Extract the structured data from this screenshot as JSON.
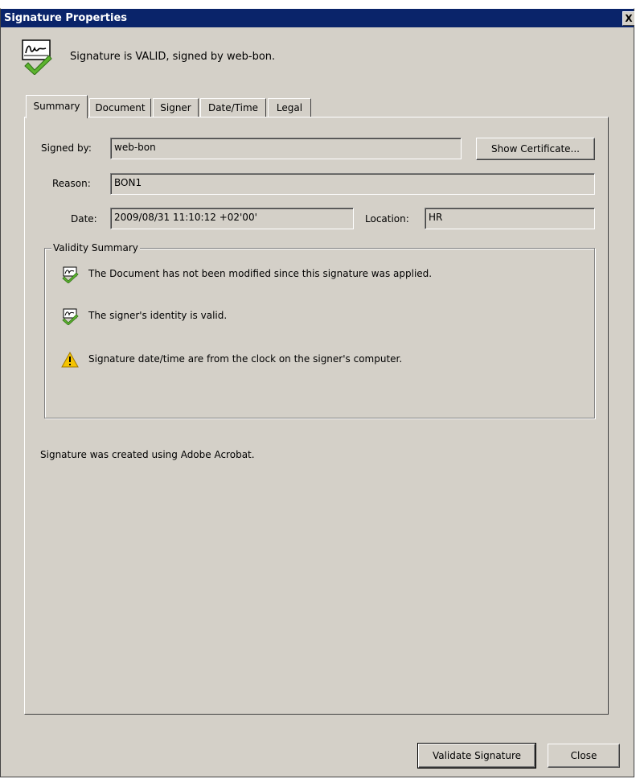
{
  "window": {
    "title": "Signature Properties",
    "close_glyph": "X"
  },
  "header": {
    "icon": "signature-valid-icon",
    "text": "Signature is VALID, signed by web-bon."
  },
  "tabs": [
    {
      "label": "Summary",
      "active": true
    },
    {
      "label": "Document",
      "active": false
    },
    {
      "label": "Signer",
      "active": false
    },
    {
      "label": "Date/Time",
      "active": false
    },
    {
      "label": "Legal",
      "active": false
    }
  ],
  "summary": {
    "signed_by_label": "Signed by:",
    "signed_by_value": "web-bon",
    "show_certificate_label": "Show Certificate...",
    "reason_label": "Reason:",
    "reason_value": "BON1",
    "date_label": "Date:",
    "date_value": "2009/08/31 11:10:12 +02'00'",
    "location_label": "Location:",
    "location_value": "HR"
  },
  "validity": {
    "title": "Validity Summary",
    "items": [
      {
        "icon": "signature-check-icon",
        "text": "The Document has not been modified since this signature was applied."
      },
      {
        "icon": "signature-check-icon",
        "text": "The signer's identity is valid."
      },
      {
        "icon": "warning-icon",
        "text": "Signature date/time are from the clock on the signer's computer."
      }
    ]
  },
  "footer_note": "Signature was created using Adobe Acrobat.",
  "buttons": {
    "validate_label": "Validate Signature",
    "close_label": "Close"
  },
  "colors": {
    "titlebar": "#0a246a",
    "dialog_bg": "#d4d0c8",
    "check": "#5cb32e",
    "warning": "#f5c400"
  }
}
